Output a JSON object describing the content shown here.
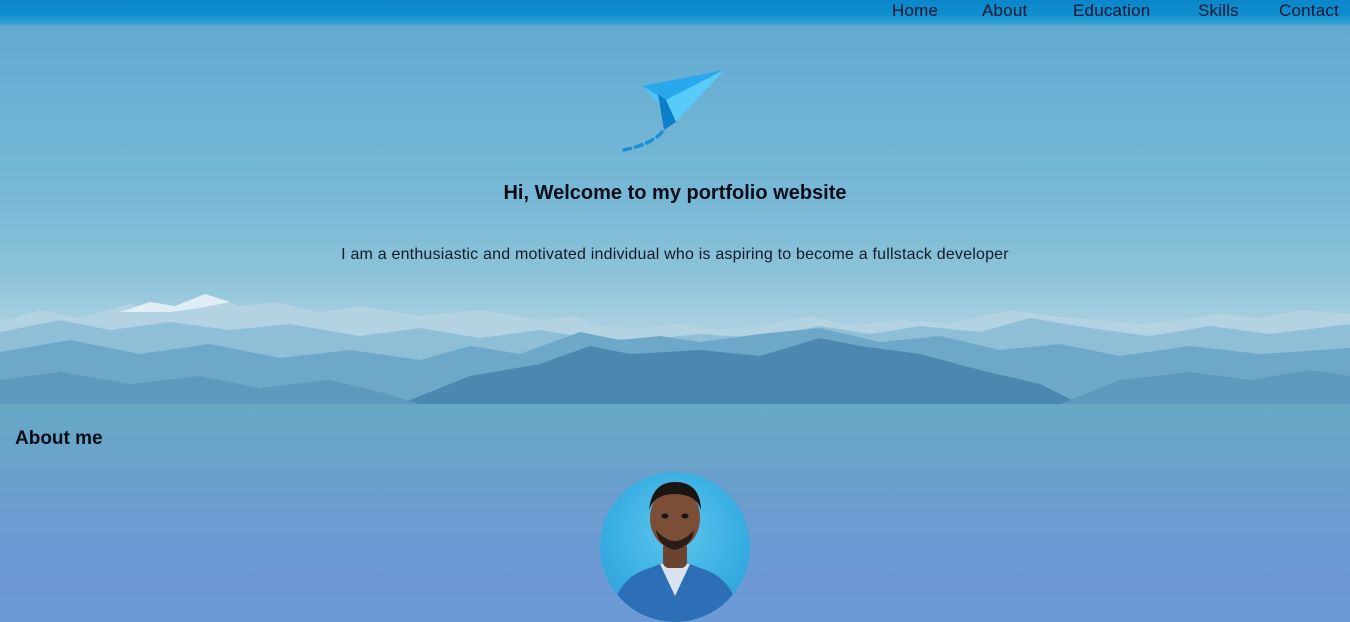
{
  "nav": {
    "items": [
      {
        "label": "Home"
      },
      {
        "label": "About"
      },
      {
        "label": "Education"
      },
      {
        "label": "Skills"
      },
      {
        "label": "Contact"
      }
    ]
  },
  "hero": {
    "icon": "paper-plane-icon",
    "title": "Hi, Welcome to my portfolio website",
    "subtitle": "I am a enthusiastic and motivated individual who is aspiring to become a fullstack developer"
  },
  "about": {
    "heading": "About me"
  },
  "colors": {
    "nav_bar": "#0a86c9",
    "nav_text": "#0b1730",
    "hero_sky": "#79b9d6",
    "plane_light": "#4fc3f7",
    "plane_dark": "#0b7fc7",
    "section_bg": "#6c9ad6",
    "avatar_bg": "#39aee2"
  }
}
